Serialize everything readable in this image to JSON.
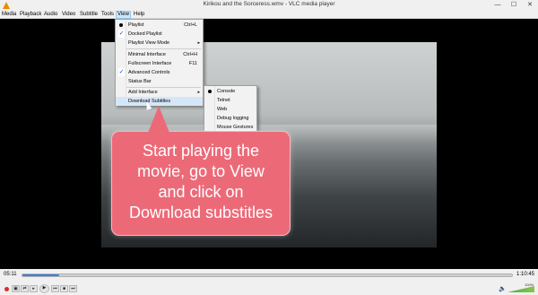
{
  "window": {
    "title": "Kirikou and the Sorceress.wmv - VLC media player",
    "minimize": "—",
    "maximize": "☐",
    "close": "✕"
  },
  "menubar": [
    "Media",
    "Playback",
    "Audio",
    "Video",
    "Subtitle",
    "Tools",
    "View",
    "Help"
  ],
  "view_menu": {
    "items": [
      {
        "label": "Playlist",
        "shortcut": "Ctrl+L",
        "mark": "dot"
      },
      {
        "label": "Docked Playlist",
        "shortcut": "",
        "mark": "check"
      },
      {
        "label": "Playlist View Mode",
        "shortcut": "",
        "mark": "",
        "submenu": "▸"
      },
      {
        "label": "Minimal Interface",
        "shortcut": "Ctrl+H",
        "mark": ""
      },
      {
        "label": "Fullscreen Interface",
        "shortcut": "F11",
        "mark": ""
      },
      {
        "label": "Advanced Controls",
        "shortcut": "",
        "mark": "check"
      },
      {
        "label": "Status Bar",
        "shortcut": "",
        "mark": ""
      },
      {
        "label": "Add Interface",
        "shortcut": "",
        "mark": "",
        "submenu": "▸"
      },
      {
        "label": "Download Subtitles",
        "shortcut": "",
        "mark": ""
      }
    ]
  },
  "interface_submenu": {
    "items": [
      {
        "label": "Console",
        "mark": "dot"
      },
      {
        "label": "Telnet",
        "mark": ""
      },
      {
        "label": "Web",
        "mark": ""
      },
      {
        "label": "Debug logging",
        "mark": ""
      },
      {
        "label": "Mouse Gestures",
        "mark": ""
      }
    ]
  },
  "callout": {
    "text": "Start playing the\nmovie, go to View\nand click on\nDownload substitles",
    "color": "#ec6a78"
  },
  "controls": {
    "elapsed": "05:11",
    "total": "1:10:45",
    "progress": 0.075,
    "volume_label": "100%",
    "buttons": [
      "record-icon",
      "snapshot-icon",
      "loop-ab-icon",
      "frame-step-icon",
      "play-icon",
      "prev-icon",
      "stop-icon",
      "next-icon",
      "fullscreen-icon",
      "extended-settings-icon",
      "playlist-icon",
      "loop-icon",
      "shuffle-icon"
    ]
  },
  "colors": {
    "accent": "#3c7ed8",
    "menu_highlight": "#d5e6f7",
    "vlc_orange": "#f08a00"
  }
}
